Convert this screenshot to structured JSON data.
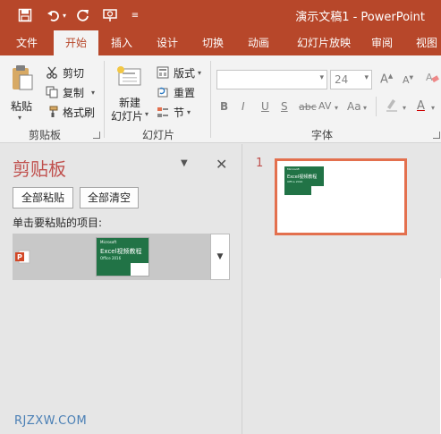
{
  "colors": {
    "accent": "#b7472a",
    "pane_title": "#c0504d",
    "thumb_border": "#e3704e",
    "excel_green": "#217346"
  },
  "titlebar": {
    "title": "演示文稿1 - PowerPoint",
    "qat": [
      {
        "icon": "save-icon"
      },
      {
        "icon": "undo-icon"
      },
      {
        "icon": "redo-icon"
      },
      {
        "icon": "present-from-start-icon"
      },
      {
        "icon": "customize-qat-icon"
      }
    ]
  },
  "tabs": [
    "文件",
    "开始",
    "插入",
    "设计",
    "切换",
    "动画",
    "幻灯片放映",
    "审阅",
    "视图"
  ],
  "active_tab": "开始",
  "ribbon": {
    "clipboard": {
      "paste": "粘贴",
      "cut": "剪切",
      "copy": "复制",
      "format_painter": "格式刷",
      "label": "剪贴板"
    },
    "slides": {
      "new_slide_line1": "新建",
      "new_slide_line2": "幻灯片",
      "layout": "版式",
      "reset": "重置",
      "section": "节",
      "label": "幻灯片"
    },
    "font": {
      "font_name": "",
      "font_size": "24",
      "label": "字体",
      "buttons": [
        "B",
        "I",
        "U",
        "S",
        "abc",
        "AV",
        "Aa",
        "A"
      ]
    }
  },
  "clipboard_pane": {
    "title": "剪贴板",
    "paste_all": "全部粘贴",
    "clear_all": "全部清空",
    "prompt": "单击要粘贴的项目:",
    "item_thumb_brand": "Microsoft",
    "item_thumb_title": "Excel视频教程",
    "item_thumb_sub": "Office 2016"
  },
  "slide_pane": {
    "slide_number": "1",
    "thumb_brand": "Microsoft",
    "thumb_title": "Excel视频教程",
    "thumb_sub": "Office 2016"
  },
  "watermark": "RJZXW.COM"
}
